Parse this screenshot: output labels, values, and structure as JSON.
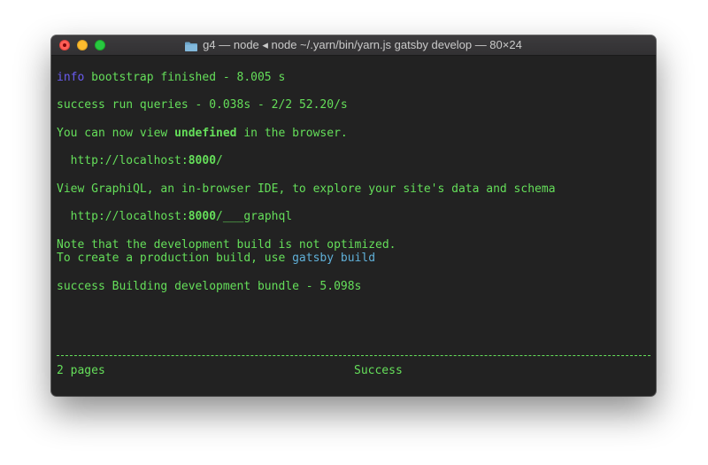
{
  "window": {
    "title": "g4 — node ◂ node ~/.yarn/bin/yarn.js gatsby develop — 80×24"
  },
  "terminal": {
    "lines": {
      "l1_prefix": "info",
      "l1_text": " bootstrap finished - 8.005 s",
      "l2_prefix": "success",
      "l2_text": " run queries - 0.038s - 2/2 52.20/s",
      "l3_a": "You can now view ",
      "l3_b": "undefined",
      "l3_c": " in the browser.",
      "l4_a": "  http://localhost:",
      "l4_b": "8000",
      "l4_c": "/",
      "l5_text": "View GraphiQL, an in-browser IDE, to explore your site's data and schema",
      "l6_a": "  http://localhost:",
      "l6_b": "8000",
      "l6_c": "/___graphql",
      "l7_text": "Note that the development build is not optimized.",
      "l8_a": "To create a production build, use ",
      "l8_b": "gatsby build",
      "l9_prefix": "success",
      "l9_text": " Building development bundle - 5.098s"
    },
    "status": {
      "pages": "2 pages",
      "state": "Success"
    }
  },
  "colors": {
    "foreground": "#65df5a",
    "info": "#6a5cf0",
    "command": "#60b0d8",
    "background": "#222222"
  }
}
